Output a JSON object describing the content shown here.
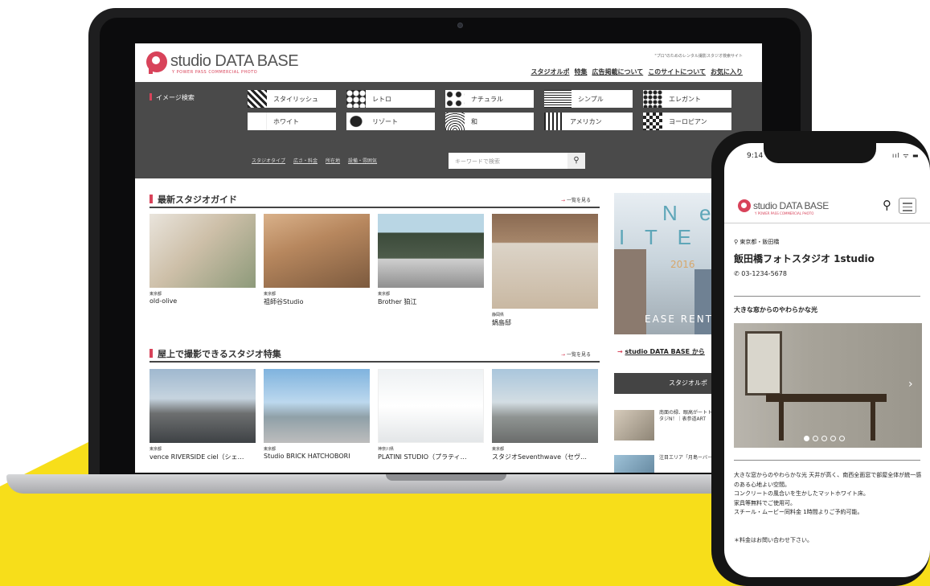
{
  "site": {
    "logo_text": "studio DATA BASE",
    "logo_sub": "Y POWER PASS   COMMERCIAL PHOTO",
    "tagline": "\"プロ\"のためのレンタル撮影スタジオ検索サイト",
    "nav": [
      "スタジオルポ",
      "特集",
      "広告掲載について",
      "このサイトについて",
      "お気に入り"
    ]
  },
  "search": {
    "label": "イメージ検索",
    "tiles": [
      {
        "label": "スタイリッシュ",
        "icon": "stylish-pattern-icon"
      },
      {
        "label": "レトロ",
        "icon": "retro-pattern-icon"
      },
      {
        "label": "ナチュラル",
        "icon": "natural-pattern-icon"
      },
      {
        "label": "シンプル",
        "icon": "simple-pattern-icon"
      },
      {
        "label": "エレガント",
        "icon": "elegant-pattern-icon"
      },
      {
        "label": "ホワイト",
        "icon": "white-pattern-icon"
      },
      {
        "label": "リゾート",
        "icon": "resort-pattern-icon"
      },
      {
        "label": "和",
        "icon": "japanese-pattern-icon"
      },
      {
        "label": "アメリカン",
        "icon": "american-pattern-icon"
      },
      {
        "label": "ヨーロピアン",
        "icon": "european-pattern-icon"
      }
    ],
    "subnav": [
      "スタジオタイプ",
      "広さ・料金",
      "所在地",
      "設備・雰囲気"
    ],
    "placeholder": "キーワードで検索",
    "button_icon": "search-icon"
  },
  "guide": {
    "title": "最新スタジオガイド",
    "more": "一覧を見る",
    "cards": [
      {
        "pref": "東京都",
        "name": "old-olive"
      },
      {
        "pref": "東京都",
        "name": "祖師谷Studio"
      },
      {
        "pref": "東京都",
        "name": "Brother 狛江"
      },
      {
        "pref": "静岡県",
        "name": "鍋島邸"
      }
    ]
  },
  "feature": {
    "title": "屋上で撮影できるスタジオ特集",
    "more": "一覧を見る",
    "cards": [
      {
        "pref": "東京都",
        "name": "vence RIVERSIDE ciel（シェ…"
      },
      {
        "pref": "東京都",
        "name": "Studio BRICK HATCHOBORI"
      },
      {
        "pref": "神奈川県",
        "name": "PLATINI STUDIO（プラティ…"
      },
      {
        "pref": "東京都",
        "name": "スタジオSeventhwave（セヴ…"
      }
    ]
  },
  "sidebar": {
    "banner_line1": "N e w",
    "banner_line2": "I T E M",
    "banner_year": "2016",
    "banner_bottom": "EASE RENT",
    "link": "studio DATA BASE から",
    "head": "スタジオルポ",
    "items": [
      "南面の緑、眼高がートト、かつてなミアム・スタジN！｜表参道ART",
      "注目エリア「月島ーバースの撮影"
    ]
  },
  "phone": {
    "time": "9:14",
    "status": "ııl ᯤ ▬",
    "logo_text": "studio DATA BASE",
    "logo_sub": "Y POWER PASS  COMMERCIAL PHOTO",
    "location": "東京都・飯田橋",
    "title": "飯田橋フォトスタジオ 1studio",
    "tel": "03-1234-5678",
    "subtitle": "大きな窓からのやわらかな光",
    "description": [
      "大きな窓からのやわらかな光 天井が高く、南西全面窓で部屋全体が統一感のある心地よい空間。",
      "コンクリートの風合いを生かしたマットホワイト床。",
      "家具等無料でご使用可。",
      "スチール・ムービー同料金 1時間よりご予約可能。"
    ],
    "note": "＊料金はお問い合わせ下さい。",
    "slide_count": 5,
    "active_slide": 1
  },
  "colors": {
    "accent": "#d8435a",
    "band": "#4a4a4a",
    "yellow": "#f7de1a"
  }
}
